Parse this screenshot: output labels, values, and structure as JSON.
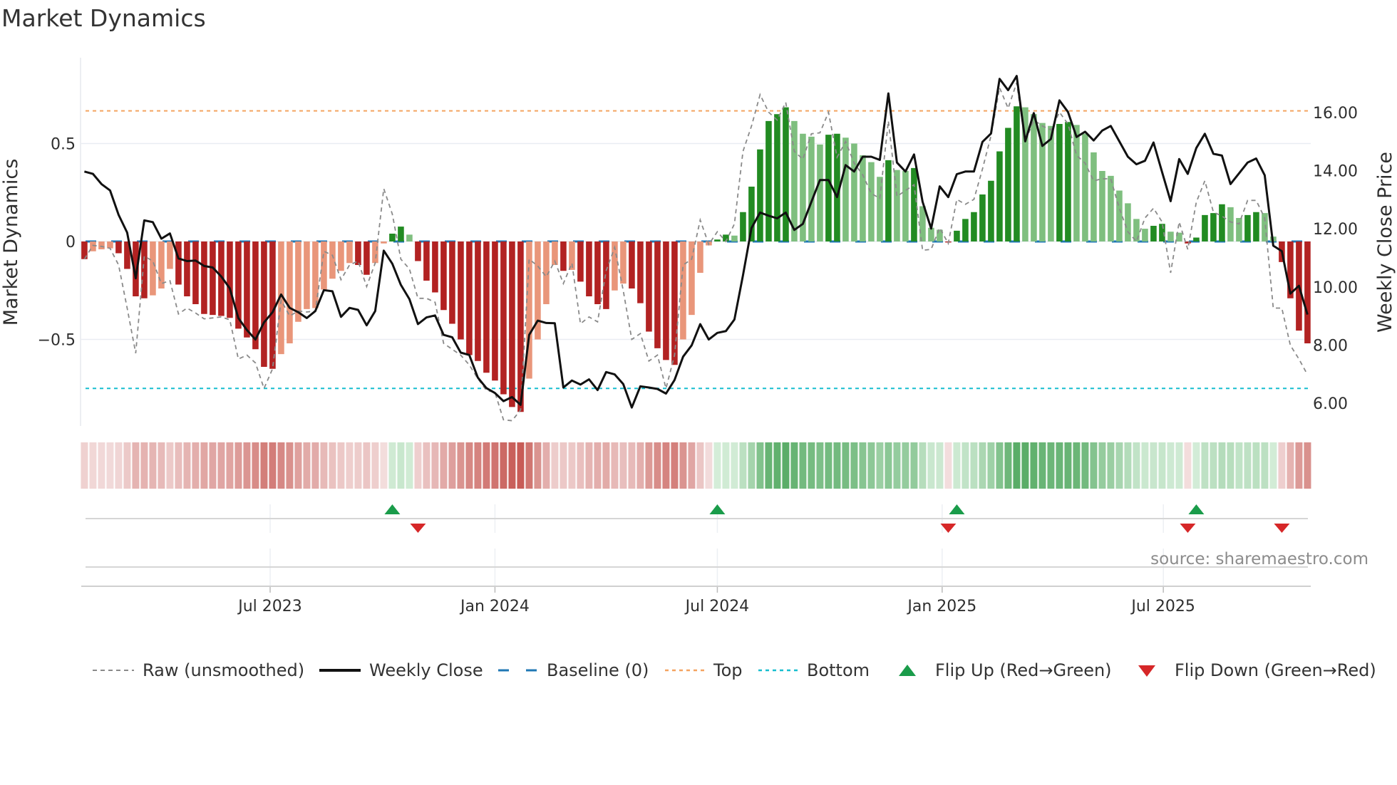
{
  "title": "Market Dynamics",
  "source": "source: sharemaestro.com",
  "chart_data": {
    "type": "bar",
    "title": "Market Dynamics",
    "ylabel": "Market Dynamics",
    "y2label": "Weekly Close Price",
    "ylim": [
      -0.94,
      0.94
    ],
    "y2lim": [
      5.22,
      17.89
    ],
    "yticks": [
      {
        "v": 0.5,
        "label": "0.5"
      },
      {
        "v": 0,
        "label": "0"
      },
      {
        "v": -0.5,
        "label": "−0.5"
      }
    ],
    "y2ticks": [
      {
        "v": 16,
        "label": "16.00"
      },
      {
        "v": 14,
        "label": "14.00"
      },
      {
        "v": 12,
        "label": "12.00"
      },
      {
        "v": 10,
        "label": "10.00"
      },
      {
        "v": 8,
        "label": "8.00"
      },
      {
        "v": 6,
        "label": "6.00"
      }
    ],
    "xticks": [
      {
        "date": "2023-07-01",
        "label": "Jul 2023"
      },
      {
        "date": "2024-01-01",
        "label": "Jan 2024"
      },
      {
        "date": "2024-07-01",
        "label": "Jul 2024"
      },
      {
        "date": "2025-01-01",
        "label": "Jan 2025"
      },
      {
        "date": "2025-07-01",
        "label": "Jul 2025"
      }
    ],
    "start_date": "2023-01-30",
    "interval_days": 7,
    "reference_lines": {
      "baseline": 0,
      "top": 0.667,
      "bottom": -0.75
    },
    "colors": {
      "red_strong": "#b22222",
      "red_weak": "#e9967a",
      "green_strong": "#228b22",
      "green_weak": "#7fbf7f",
      "close": "#111111",
      "raw": "#8a8a8a",
      "baseline": "#1f77b4",
      "top": "#f4a460",
      "bottom": "#17becf",
      "flip_up": "#1a9c4a",
      "flip_down": "#d62728"
    },
    "series": [
      {
        "name": "Market Dynamics (smoothed)",
        "axis": "left",
        "type": "bar",
        "values": [
          -0.09,
          -0.05,
          -0.04,
          -0.035,
          -0.06,
          -0.14,
          -0.28,
          -0.29,
          -0.275,
          -0.24,
          -0.14,
          -0.22,
          -0.28,
          -0.32,
          -0.37,
          -0.375,
          -0.38,
          -0.39,
          -0.445,
          -0.49,
          -0.55,
          -0.64,
          -0.65,
          -0.575,
          -0.52,
          -0.41,
          -0.345,
          -0.34,
          -0.245,
          -0.19,
          -0.15,
          -0.11,
          -0.12,
          -0.17,
          -0.11,
          -0.01,
          0.04,
          0.076,
          0.035,
          -0.1,
          -0.2,
          -0.26,
          -0.35,
          -0.42,
          -0.5,
          -0.58,
          -0.61,
          -0.67,
          -0.71,
          -0.78,
          -0.845,
          -0.87,
          -0.7,
          -0.5,
          -0.32,
          -0.12,
          -0.15,
          -0.145,
          -0.205,
          -0.28,
          -0.32,
          -0.345,
          -0.25,
          -0.215,
          -0.24,
          -0.315,
          -0.46,
          -0.545,
          -0.605,
          -0.63,
          -0.5,
          -0.375,
          -0.16,
          -0.02,
          0.01,
          0.035,
          0.03,
          0.15,
          0.28,
          0.47,
          0.615,
          0.65,
          0.685,
          0.615,
          0.55,
          0.535,
          0.495,
          0.545,
          0.55,
          0.53,
          0.5,
          0.44,
          0.405,
          0.33,
          0.415,
          0.365,
          0.36,
          0.375,
          0.18,
          0.07,
          0.06,
          -0.005,
          0.055,
          0.115,
          0.15,
          0.24,
          0.31,
          0.46,
          0.58,
          0.69,
          0.685,
          0.65,
          0.605,
          0.59,
          0.6,
          0.61,
          0.595,
          0.55,
          0.455,
          0.36,
          0.335,
          0.26,
          0.195,
          0.115,
          0.065,
          0.08,
          0.09,
          0.05,
          0.045,
          -0.01,
          0.02,
          0.135,
          0.145,
          0.19,
          0.175,
          0.12,
          0.135,
          0.15,
          0.145,
          0.025,
          -0.105,
          -0.29,
          -0.455,
          -0.52
        ]
      },
      {
        "name": "Raw (unsmoothed)",
        "axis": "left",
        "type": "line",
        "values": [
          -0.09,
          -0.02,
          -0.025,
          -0.035,
          -0.12,
          -0.34,
          -0.57,
          -0.075,
          -0.1,
          -0.215,
          -0.2,
          -0.37,
          -0.34,
          -0.365,
          -0.395,
          -0.39,
          -0.385,
          -0.4,
          -0.6,
          -0.58,
          -0.62,
          -0.75,
          -0.65,
          -0.3,
          -0.38,
          -0.355,
          -0.36,
          -0.355,
          -0.05,
          -0.07,
          -0.195,
          -0.12,
          -0.1,
          -0.23,
          -0.11,
          0.27,
          0.14,
          -0.09,
          -0.14,
          -0.29,
          -0.29,
          -0.31,
          -0.52,
          -0.55,
          -0.58,
          -0.63,
          -0.7,
          -0.76,
          -0.77,
          -0.91,
          -0.915,
          -0.86,
          -0.09,
          -0.125,
          -0.18,
          -0.1,
          -0.215,
          -0.11,
          -0.42,
          -0.385,
          -0.41,
          -0.15,
          -0.03,
          -0.25,
          -0.5,
          -0.47,
          -0.61,
          -0.58,
          -0.75,
          -0.58,
          -0.12,
          -0.09,
          0.11,
          -0.015,
          0.05,
          0.0,
          0.09,
          0.46,
          0.59,
          0.75,
          0.66,
          0.62,
          0.71,
          0.46,
          0.42,
          0.55,
          0.555,
          0.66,
          0.43,
          0.51,
          0.4,
          0.34,
          0.245,
          0.22,
          0.615,
          0.23,
          0.26,
          0.29,
          -0.045,
          -0.04,
          0.07,
          -0.01,
          0.215,
          0.19,
          0.215,
          0.37,
          0.54,
          0.785,
          0.68,
          0.81,
          0.51,
          0.62,
          0.59,
          0.57,
          0.66,
          0.6,
          0.44,
          0.4,
          0.31,
          0.32,
          0.32,
          0.17,
          0.05,
          0.0,
          0.12,
          0.17,
          0.1,
          -0.16,
          0.1,
          -0.04,
          0.2,
          0.31,
          0.15,
          0.13,
          0.1,
          0.09,
          0.21,
          0.21,
          0.12,
          -0.34,
          -0.34,
          -0.53,
          -0.6,
          -0.68
        ]
      },
      {
        "name": "Weekly Close",
        "axis": "right",
        "type": "line",
        "values": [
          13.97,
          13.89,
          13.54,
          13.32,
          12.48,
          11.87,
          10.3,
          12.29,
          12.23,
          11.66,
          11.84,
          10.98,
          10.89,
          10.91,
          10.72,
          10.67,
          10.36,
          9.95,
          8.93,
          8.52,
          8.19,
          8.78,
          9.13,
          9.74,
          9.28,
          9.13,
          8.93,
          9.17,
          9.89,
          9.85,
          8.97,
          9.28,
          9.21,
          8.68,
          9.17,
          11.25,
          10.8,
          10.07,
          9.58,
          8.72,
          8.95,
          9.02,
          8.35,
          8.27,
          7.74,
          7.66,
          6.88,
          6.52,
          6.35,
          6.07,
          6.21,
          5.94,
          8.35,
          8.84,
          8.76,
          8.75,
          6.54,
          6.78,
          6.64,
          6.82,
          6.45,
          7.07,
          6.99,
          6.66,
          5.85,
          6.58,
          6.54,
          6.49,
          6.33,
          6.8,
          7.6,
          7.99,
          8.72,
          8.19,
          8.42,
          8.48,
          8.88,
          10.4,
          12.03,
          12.56,
          12.45,
          12.36,
          12.56,
          11.96,
          12.17,
          12.93,
          13.68,
          13.68,
          13.09,
          14.19,
          13.97,
          14.48,
          14.48,
          14.37,
          16.66,
          14.28,
          13.97,
          14.56,
          12.93,
          12.01,
          13.46,
          13.09,
          13.88,
          13.97,
          13.97,
          14.99,
          15.28,
          17.16,
          16.77,
          17.26,
          15.01,
          15.98,
          14.85,
          15.09,
          16.42,
          16.02,
          15.16,
          15.34,
          15.04,
          15.38,
          15.54,
          15.01,
          14.48,
          14.22,
          14.34,
          14.97,
          13.95,
          12.95,
          14.4,
          13.89,
          14.78,
          15.27,
          14.58,
          14.52,
          13.54,
          13.91,
          14.28,
          14.42,
          13.84,
          11.42,
          11.23,
          9.77,
          10.04,
          9.05
        ]
      }
    ],
    "legend": {
      "placement": "bottom",
      "entries": [
        {
          "key": "raw",
          "label": "Raw (unsmoothed)"
        },
        {
          "key": "close",
          "label": "Weekly Close"
        },
        {
          "key": "baseline",
          "label": "Baseline (0)"
        },
        {
          "key": "top",
          "label": "Top"
        },
        {
          "key": "bottom",
          "label": "Bottom"
        },
        {
          "key": "flip_up",
          "label": "Flip Up (Red→Green)"
        },
        {
          "key": "flip_down",
          "label": "Flip Down (Green→Red)"
        }
      ]
    }
  }
}
